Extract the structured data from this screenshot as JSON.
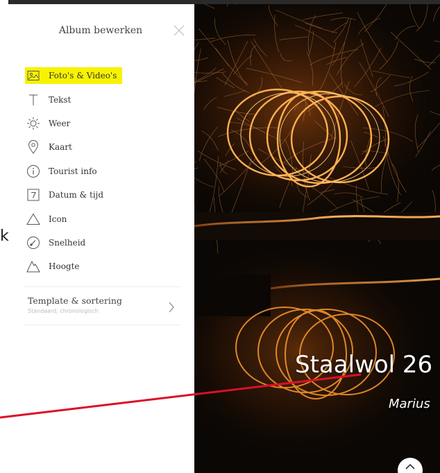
{
  "panel": {
    "title": "Album bewerken",
    "close_icon": "close-icon"
  },
  "menu": {
    "items": [
      {
        "label": "Foto's & Video's",
        "icon": "photo-icon",
        "active": true
      },
      {
        "label": "Tekst",
        "icon": "text-icon"
      },
      {
        "label": "Weer",
        "icon": "sun-icon"
      },
      {
        "label": "Kaart",
        "icon": "map-pin-icon"
      },
      {
        "label": "Tourist info",
        "icon": "info-icon"
      },
      {
        "label": "Datum & tijd",
        "icon": "calendar-icon"
      },
      {
        "label": "Icon",
        "icon": "triangle-icon"
      },
      {
        "label": "Snelheid",
        "icon": "speedometer-icon"
      },
      {
        "label": "Hoogte",
        "icon": "mountain-icon"
      }
    ]
  },
  "template": {
    "title": "Template & sortering",
    "subtitle": "Standaard, chronologisch",
    "icon": "chevron-right-icon"
  },
  "stray_text": "k",
  "album": {
    "title": "Staalwol 26",
    "author": "Marius"
  },
  "colors": {
    "highlight": "#f7f300",
    "annotation_line": "#d9102a",
    "sparks": "#ff9a2e"
  }
}
